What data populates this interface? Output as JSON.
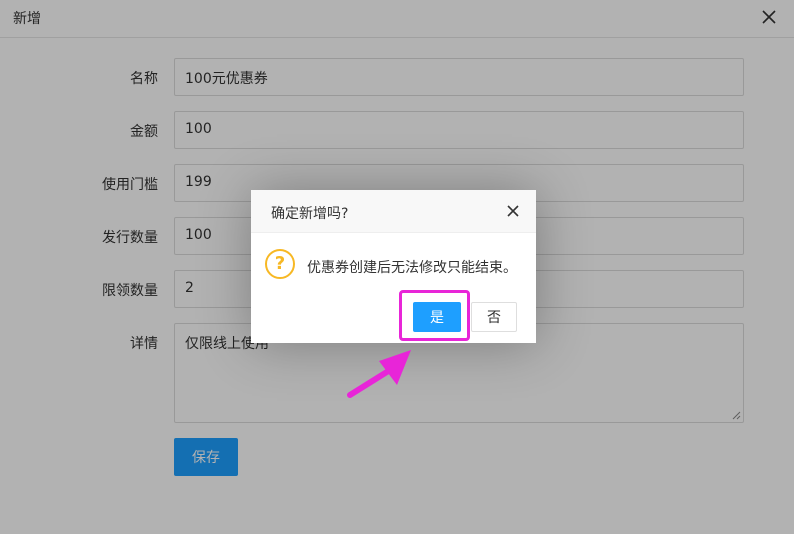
{
  "header": {
    "title": "新增",
    "close_icon": "close-icon"
  },
  "form": {
    "fields": [
      {
        "label": "名称",
        "value": "100元优惠券"
      },
      {
        "label": "金额",
        "value": "100"
      },
      {
        "label": "使用门槛",
        "value": "199"
      },
      {
        "label": "发行数量",
        "value": "100"
      },
      {
        "label": "限领数量",
        "value": "2"
      }
    ],
    "detail": {
      "label": "详情",
      "value": "仅限线上使用"
    },
    "save_label": "保存"
  },
  "dialog": {
    "title": "确定新增吗?",
    "icon_glyph": "?",
    "message": "优惠券创建后无法修改只能结束。",
    "yes_label": "是",
    "no_label": "否"
  },
  "colors": {
    "primary": "#1e9fff",
    "warning": "#f7b824",
    "annotation": "#e825d8"
  }
}
